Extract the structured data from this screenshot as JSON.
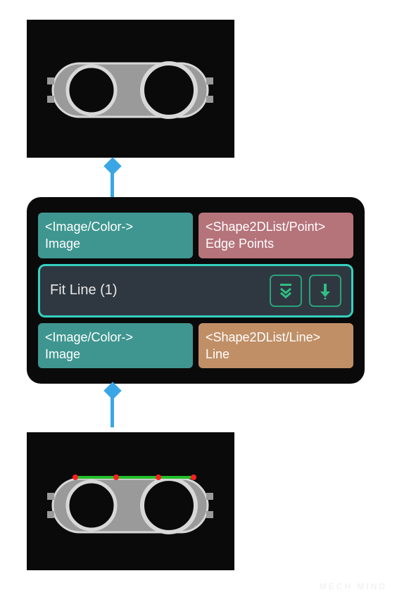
{
  "node": {
    "title": "Fit Line (1)",
    "inputs": [
      {
        "type": "<Image/Color->",
        "label": "Image"
      },
      {
        "type": "<Shape2DList/Point>",
        "label": "Edge Points"
      }
    ],
    "outputs": [
      {
        "type": "<Image/Color->",
        "label": "Image"
      },
      {
        "type": "<Shape2DList/Line>",
        "label": "Line"
      }
    ],
    "buttons": {
      "expand": "expand-down-icon",
      "run": "run-down-icon"
    }
  },
  "colors": {
    "teal": "#3f9690",
    "rose": "#b5737a",
    "tan": "#c08f66",
    "accent": "#35d1bf",
    "connector": "#3aa6e6"
  },
  "watermark": "MECH MIND"
}
